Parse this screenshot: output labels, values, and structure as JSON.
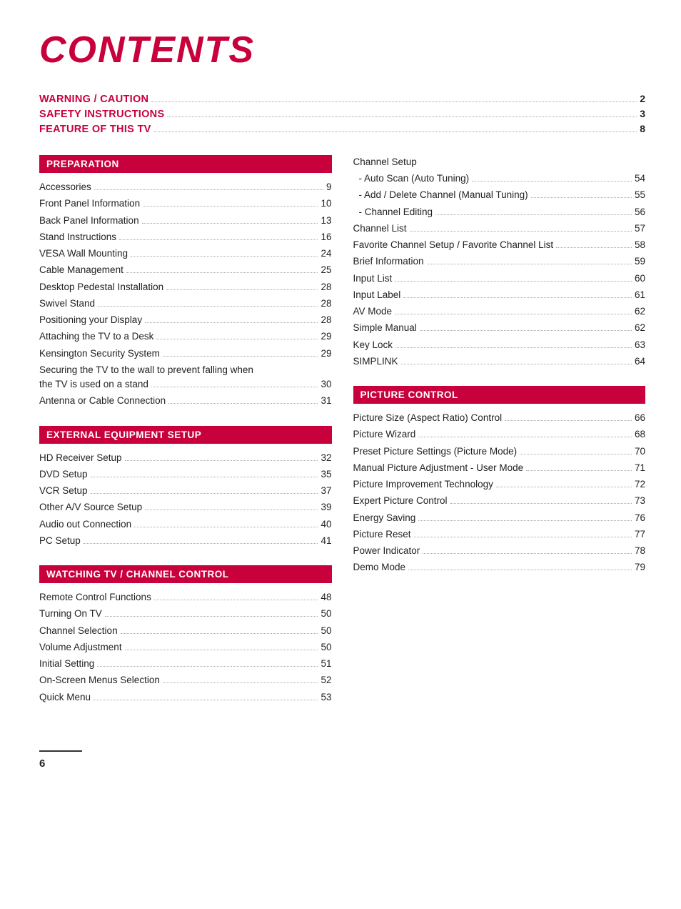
{
  "title": "CONTENTS",
  "top_links": [
    {
      "label": "WARNING / CAUTION",
      "dots": true,
      "page": "2"
    },
    {
      "label": "SAFETY INSTRUCTIONS",
      "dots": true,
      "page": "3"
    },
    {
      "label": "FEATURE OF THIS TV",
      "dots": true,
      "page": "8"
    }
  ],
  "sections": {
    "left": [
      {
        "header": "PREPARATION",
        "items": [
          {
            "label": "Accessories",
            "page": "9"
          },
          {
            "label": "Front Panel Information",
            "page": "10"
          },
          {
            "label": "Back Panel Information",
            "page": "13"
          },
          {
            "label": "Stand Instructions",
            "page": "16"
          },
          {
            "label": "VESA Wall Mounting",
            "page": "24"
          },
          {
            "label": "Cable Management",
            "page": "25"
          },
          {
            "label": "Desktop Pedestal Installation",
            "page": "28"
          },
          {
            "label": "Swivel Stand",
            "page": "28"
          },
          {
            "label": "Positioning your Display",
            "page": "28"
          },
          {
            "label": "Attaching the TV to a Desk",
            "page": "29"
          },
          {
            "label": "Kensington Security System",
            "page": "29"
          },
          {
            "label": "Securing the TV to the wall to prevent falling when the TV is used on a stand",
            "page": "30",
            "multiline": true,
            "line2": "the TV is used on a stand"
          },
          {
            "label": "Antenna or Cable Connection",
            "page": "31"
          }
        ]
      },
      {
        "header": "EXTERNAL EQUIPMENT SETUP",
        "items": [
          {
            "label": "HD Receiver Setup",
            "page": "32"
          },
          {
            "label": "DVD Setup",
            "page": "35"
          },
          {
            "label": "VCR Setup",
            "page": "37"
          },
          {
            "label": "Other A/V Source Setup",
            "page": "39"
          },
          {
            "label": "Audio out Connection",
            "page": "40"
          },
          {
            "label": "PC Setup",
            "page": "41"
          }
        ]
      },
      {
        "header": "WATCHING TV / CHANNEL CONTROL",
        "items": [
          {
            "label": "Remote Control Functions",
            "page": "48"
          },
          {
            "label": "Turning On TV",
            "page": "50"
          },
          {
            "label": "Channel Selection",
            "page": "50"
          },
          {
            "label": "Volume Adjustment",
            "page": "50"
          },
          {
            "label": "Initial Setting",
            "page": "51"
          },
          {
            "label": "On-Screen Menus Selection",
            "page": "52"
          },
          {
            "label": "Quick Menu",
            "page": "53"
          }
        ]
      }
    ],
    "right": [
      {
        "header": null,
        "channel_setup": true,
        "channel_setup_label": "Channel Setup",
        "items": [
          {
            "label": "- Auto Scan (Auto Tuning)",
            "page": "54",
            "sub": true
          },
          {
            "label": "- Add / Delete Channel (Manual Tuning)",
            "page": "55",
            "sub": true
          },
          {
            "label": "- Channel Editing",
            "page": "56",
            "sub": true
          },
          {
            "label": "Channel List",
            "page": "57"
          },
          {
            "label": "Favorite Channel Setup / Favorite Channel List",
            "page": "58"
          },
          {
            "label": "Brief Information",
            "page": "59"
          },
          {
            "label": "Input List",
            "page": "60"
          },
          {
            "label": "Input Label",
            "page": "61"
          },
          {
            "label": "AV Mode",
            "page": "62"
          },
          {
            "label": "Simple Manual",
            "page": "62"
          },
          {
            "label": "Key Lock",
            "page": "63"
          },
          {
            "label": "SIMPLINK",
            "page": "64"
          }
        ]
      },
      {
        "header": "PICTURE CONTROL",
        "items": [
          {
            "label": "Picture Size (Aspect Ratio) Control",
            "page": "66"
          },
          {
            "label": "Picture Wizard",
            "page": "68"
          },
          {
            "label": "Preset Picture Settings (Picture Mode)",
            "page": "70"
          },
          {
            "label": "Manual Picture Adjustment - User Mode",
            "page": "71"
          },
          {
            "label": "Picture Improvement Technology",
            "page": "72"
          },
          {
            "label": "Expert Picture Control",
            "page": "73"
          },
          {
            "label": "Energy Saving",
            "page": "76"
          },
          {
            "label": "Picture Reset",
            "page": "77"
          },
          {
            "label": "Power Indicator",
            "page": "78"
          },
          {
            "label": "Demo Mode",
            "page": "79"
          }
        ]
      }
    ]
  },
  "page_number": "6"
}
